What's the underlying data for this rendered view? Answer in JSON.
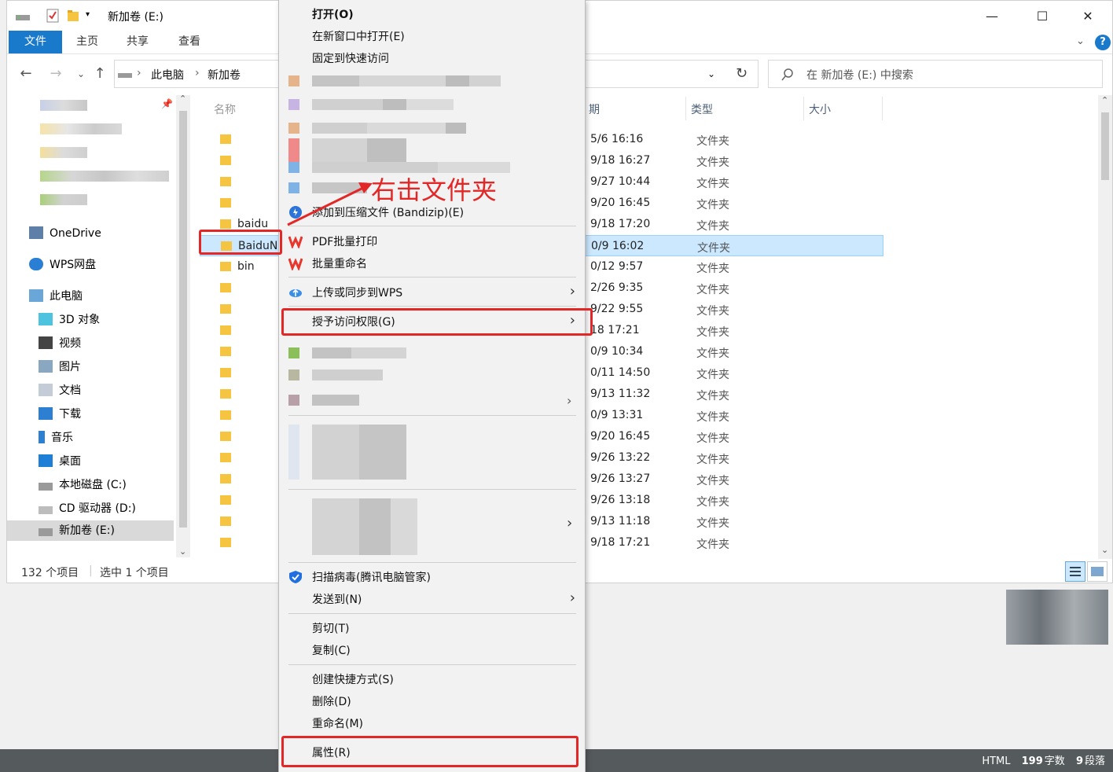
{
  "window": {
    "title": "新加卷 (E:)",
    "controls": {
      "minimize": "—",
      "maximize": "☐",
      "close": "✕"
    }
  },
  "ribbon": {
    "tabs": [
      "文件",
      "主页",
      "共享",
      "查看"
    ],
    "help": "?"
  },
  "address": {
    "items": [
      "此电脑",
      "新加卷"
    ],
    "search_placeholder": "在 新加卷 (E:) 中搜索"
  },
  "nav_pane": {
    "items": [
      {
        "label": "OneDrive",
        "icon": "onedrive-icon"
      },
      {
        "label": "WPS网盘",
        "icon": "cloud-icon"
      },
      {
        "label": "此电脑",
        "icon": "computer-icon"
      },
      {
        "label": "3D 对象",
        "icon": "cube-icon"
      },
      {
        "label": "视频",
        "icon": "video-icon"
      },
      {
        "label": "图片",
        "icon": "picture-icon"
      },
      {
        "label": "文档",
        "icon": "document-icon"
      },
      {
        "label": "下载",
        "icon": "download-icon"
      },
      {
        "label": "音乐",
        "icon": "music-icon"
      },
      {
        "label": "桌面",
        "icon": "desktop-icon"
      },
      {
        "label": "本地磁盘 (C:)",
        "icon": "drive-icon"
      },
      {
        "label": "CD 驱动器 (D:)",
        "icon": "cd-drive-icon"
      },
      {
        "label": "新加卷 (E:)",
        "icon": "drive-icon",
        "selected": true
      }
    ]
  },
  "columns": {
    "name": "名称",
    "date": "期",
    "type": "类型",
    "size": "大小"
  },
  "files": [
    {
      "name": "",
      "date": "5/6 16:16",
      "type": "文件夹"
    },
    {
      "name": "",
      "date": "9/18 16:27",
      "type": "文件夹"
    },
    {
      "name": "",
      "date": "9/27 10:44",
      "type": "文件夹"
    },
    {
      "name": "",
      "date": "9/20 16:45",
      "type": "文件夹"
    },
    {
      "name": "baidu",
      "date": "9/18 17:20",
      "type": "文件夹"
    },
    {
      "name": "BaiduNe",
      "date": "0/9 16:02",
      "type": "文件夹",
      "selected": true
    },
    {
      "name": "bin",
      "date": "0/12 9:57",
      "type": "文件夹"
    },
    {
      "name": "",
      "date": "2/26 9:35",
      "type": "文件夹"
    },
    {
      "name": "",
      "date": "9/22 9:55",
      "type": "文件夹"
    },
    {
      "name": "",
      "date": "18 17:21",
      "type": "文件夹"
    },
    {
      "name": "",
      "date": "0/9 10:34",
      "type": "文件夹"
    },
    {
      "name": "",
      "date": "0/11 14:50",
      "type": "文件夹"
    },
    {
      "name": "",
      "date": "9/13 11:32",
      "type": "文件夹"
    },
    {
      "name": "",
      "date": "0/9 13:31",
      "type": "文件夹"
    },
    {
      "name": "",
      "date": "9/20 16:45",
      "type": "文件夹"
    },
    {
      "name": "",
      "date": "9/26 13:22",
      "type": "文件夹"
    },
    {
      "name": "",
      "date": "9/26 13:27",
      "type": "文件夹"
    },
    {
      "name": "",
      "date": "9/26 13:18",
      "type": "文件夹"
    },
    {
      "name": "",
      "date": "9/13 11:18",
      "type": "文件夹"
    },
    {
      "name": "",
      "date": "9/18 17:21",
      "type": "文件夹"
    }
  ],
  "status": {
    "count": "132 个项目",
    "selected": "选中 1 个项目"
  },
  "context_menu": {
    "open": "打开(O)",
    "open_new_window": "在新窗口中打开(E)",
    "pin_quick_access": "固定到快速访问",
    "bandizip": "添加到压缩文件 (Bandizip)(E)",
    "pdf_print": "PDF批量打印",
    "batch_rename": "批量重命名",
    "wps_upload": "上传或同步到WPS",
    "grant_access": "授予访问权限(G)",
    "virus_scan": "扫描病毒(腾讯电脑管家)",
    "send_to": "发送到(N)",
    "cut": "剪切(T)",
    "copy": "复制(C)",
    "create_shortcut": "创建快捷方式(S)",
    "delete": "删除(D)",
    "rename": "重命名(M)",
    "properties": "属性(R)"
  },
  "annotation": {
    "text": "右击文件夹",
    "color": "#e32727"
  },
  "editor_status": {
    "label": "HTML",
    "words_value": "199",
    "words_label": "字数",
    "paras_value": "9",
    "paras_label": "段落"
  },
  "colors": {
    "accent": "#1979ca",
    "selection": "#cce8ff",
    "annotation": "#e32727"
  }
}
